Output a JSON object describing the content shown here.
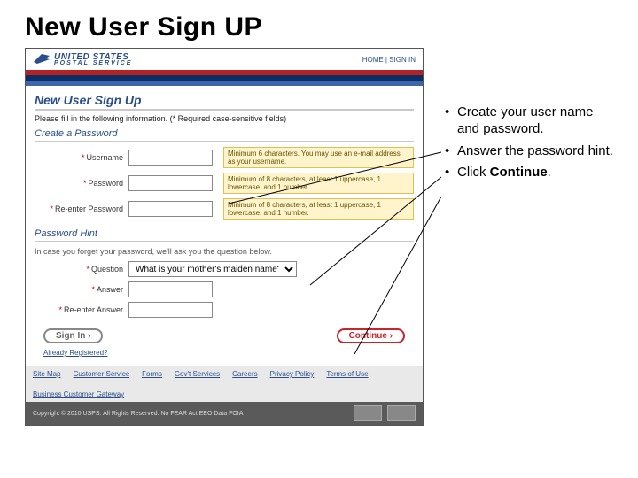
{
  "slide_title": "New User Sign UP",
  "header": {
    "brand_top": "UNITED STATES",
    "brand_bottom": "POSTAL SERVICE",
    "links": "HOME  |  SIGN IN"
  },
  "page": {
    "title": "New User Sign Up",
    "instruction": "Please fill in the following information. (* Required case-sensitive fields)"
  },
  "create": {
    "heading": "Create a Password",
    "username_label": "Username",
    "username_hint": "Minimum 6 characters. You may use an e-mail address as your username.",
    "password_label": "Password",
    "password_hint": "Minimum of 8 characters, at least 1 uppercase, 1 lowercase, and 1 number.",
    "reenter_label": "Re-enter Password",
    "reenter_hint": "Minimum of 8 characters, at least 1 uppercase, 1 lowercase, and 1 number."
  },
  "hint": {
    "heading": "Password Hint",
    "note": "In case you forget your password, we'll ask you the question below.",
    "question_label": "Question",
    "question_value": "What is your mother's maiden name?",
    "answer_label": "Answer",
    "reenter_label": "Re-enter Answer"
  },
  "buttons": {
    "signin": "Sign In ›",
    "continue": "Continue ›",
    "already": "Already Registered?"
  },
  "footer": {
    "links": [
      "Site Map",
      "Customer Service",
      "Forms",
      "Gov't Services",
      "Careers",
      "Privacy Policy",
      "Terms of Use",
      "Business Customer Gateway"
    ],
    "copyright": "Copyright © 2010 USPS. All Rights Reserved.   No FEAR Act EEO Data   FOIA"
  },
  "bullets": [
    "Create your user name and password.",
    "Answer the password hint.",
    "Click <b>Continue</b>."
  ]
}
